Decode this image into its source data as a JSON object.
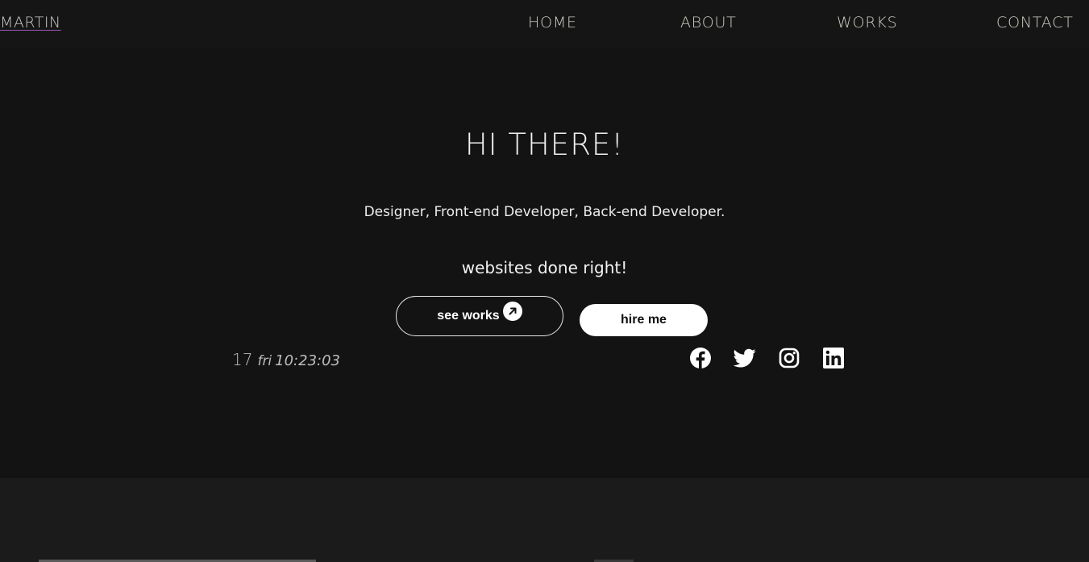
{
  "nav": {
    "brand": "MARTIN",
    "links": [
      "HOME",
      "ABOUT",
      "WORKS",
      "CONTACT"
    ]
  },
  "hero": {
    "title": "HI THERE!",
    "subtitle": "Designer, Front-end Developer, Back-end Developer.",
    "tagline": "websites done right!",
    "buttons": {
      "see_works": "see works",
      "hire_me": "hire me"
    },
    "clock": {
      "date": "17",
      "day": "fri",
      "time": "10:23:03"
    },
    "social_icons": [
      "facebook-icon",
      "twitter-icon",
      "instagram-icon",
      "linkedin-icon"
    ]
  },
  "colors": {
    "background": "#131313",
    "navbar": "#151515",
    "section_alt": "#1b1b1b",
    "text": "#f2f2f2",
    "accent_underline": "#9b59b6"
  }
}
